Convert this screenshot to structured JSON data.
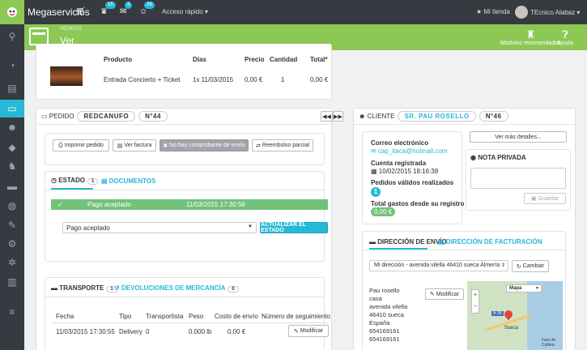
{
  "topbar": {
    "brand": "Megaservicios",
    "notifications": [
      {
        "icon": "trophy-icon",
        "count": "15"
      },
      {
        "icon": "mail-icon",
        "count": "3"
      },
      {
        "icon": "user-icon",
        "count": "29"
      }
    ],
    "quick_access": "Acceso rápido ▾",
    "shop": "★ Mi tienda",
    "user": "TEcnico Alabaz ▾"
  },
  "header": {
    "breadcrumb": "PEDIDOS",
    "title": "Ver",
    "modules_label": "Módulos recomendados",
    "help_label": "Ayuda"
  },
  "products": {
    "columns": [
      "Producto",
      "Días",
      "Precio",
      "Cantidad",
      "Total*"
    ],
    "row": {
      "name": "Entrada Concierto + Ticket",
      "days": "1x 11/03/2015",
      "price": "0,00 €",
      "qty": "1",
      "total": "0,00 €"
    }
  },
  "order": {
    "label": "PEDIDO",
    "reference": "REDCANUFO",
    "number": "N°44",
    "buttons": {
      "print": "Imprimir pedido",
      "invoice": "Ver factura",
      "no_slip": "No hay comprobante de envío",
      "refund": "Reembolso parcial"
    },
    "tabs": {
      "status": "ESTADO",
      "status_count": "1",
      "documents": "DOCUMENTOS"
    },
    "status_row": {
      "status": "Pago aceptado",
      "date": "11/03/2015 17:30:56"
    },
    "status_select": "Pago aceptado",
    "update_button": "ACTUALIZAR EL ESTADO",
    "ship_tabs": {
      "transport": "TRANSPORTE",
      "transport_count": "1",
      "returns": "DEVOLUCIONES DE MERCANCÍA",
      "returns_count": "0"
    },
    "ship_columns": [
      "Fecha",
      "Tipo",
      "Transportista",
      "Peso",
      "Costo de envío",
      "Número de seguimiento"
    ],
    "ship_row": {
      "date": "11/03/2015 17:30:55",
      "type": "Delivery",
      "carrier": "0",
      "weight": "0.000 lb",
      "cost": "0,00 €"
    },
    "modify": "Modificar"
  },
  "customer": {
    "label": "CLIENTE",
    "name": "SR. PAU ROSELLO",
    "number": "N°46",
    "details_button": "Ver más detalles...",
    "email_label": "Correo electrónico",
    "email": "cap_itaca@hotmail.com",
    "registered_label": "Cuenta registrada",
    "registered": "10/02/2015 18:16:38",
    "valid_orders_label": "Pedidos válidos realizados",
    "valid_orders": "1",
    "total_label": "Total gastos desde su registro",
    "total": "0,00 €",
    "private_note": "NOTA PRIVADA",
    "save": "Guardar",
    "addr_tabs": {
      "shipping": "DIRECCIÓN DE ENVÍO",
      "billing": "DIRECCIÓN DE FACTURACIÓN"
    },
    "address_select": "Mi dirección - avenida vilella 46410 sueca Almería",
    "change": "Cambiar",
    "address_lines": [
      "Pau rosello",
      "casa",
      "avenida vilella",
      "46410 sueca",
      "España",
      "654169161",
      "654169161"
    ],
    "map_select": "Mapa",
    "map_labels": {
      "town": "Sueca",
      "road": "A-38",
      "place": "Faro de Cullera"
    }
  }
}
